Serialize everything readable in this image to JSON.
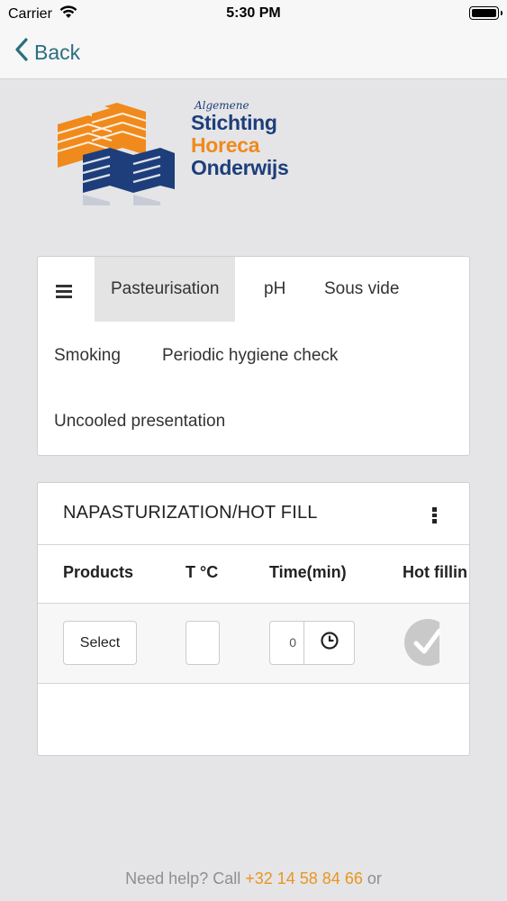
{
  "status_bar": {
    "carrier": "Carrier",
    "time": "5:30 PM",
    "icons": [
      "wifi-icon",
      "battery-icon"
    ]
  },
  "nav": {
    "back_label": "Back",
    "accent_color": "#2a6f80"
  },
  "logo": {
    "line_small": "Algemene",
    "line1": "Stichting",
    "line2": "Horeca",
    "line3": "Onderwijs",
    "colors": {
      "blue": "#1d3e7a",
      "orange": "#f08a1c"
    }
  },
  "tabs": {
    "menu_icon": "hamburger-icon",
    "items": [
      {
        "label": "Pasteurisation",
        "active": true
      },
      {
        "label": "pH",
        "active": false
      },
      {
        "label": "Sous vide",
        "active": false
      },
      {
        "label": "Smoking",
        "active": false
      },
      {
        "label": "Periodic hygiene check",
        "active": false
      },
      {
        "label": "Uncooled presentation",
        "active": false
      }
    ]
  },
  "table_card": {
    "title": "NAPASTURIZATION/HOT FILL",
    "more_icon": "kebab-menu-icon",
    "columns": [
      "Products",
      "T °C",
      "Time(min)",
      "Hot fillin"
    ],
    "row": {
      "product_button": "Select",
      "temperature_value": "",
      "time_value": "0",
      "clock_icon": "clock-icon",
      "hot_filling_icon": "checkmark-icon"
    }
  },
  "footer": {
    "prefix": "Need help? Call ",
    "phone": "+32 14 58 84 66",
    "suffix": " or",
    "phone_color": "#e8961e"
  }
}
